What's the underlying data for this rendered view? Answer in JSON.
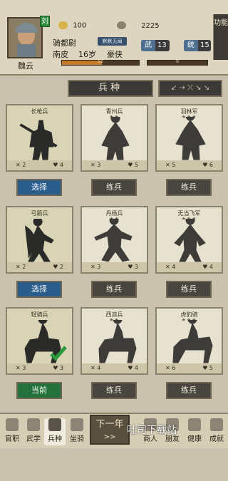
{
  "player": {
    "faction": "刘",
    "name": "魏云",
    "title_badge": "默默无闻",
    "gold": "100",
    "copper": "2225",
    "rank": "骑都尉",
    "place": "南皮",
    "age": "16岁",
    "trait": "豪侠"
  },
  "stats": {
    "wu_label": "武",
    "wu": "13",
    "tong_label": "统",
    "tong": "15"
  },
  "progress": {
    "left_value": 52,
    "left_max": 100,
    "right_value": 0,
    "right_max": 100
  },
  "func_label": "功能",
  "section_title": "兵种",
  "weapon_bar": "↙ ⇢ ⤫ ↘ ↘",
  "units": [
    {
      "name": "长枪兵",
      "stars": "",
      "atk": "2",
      "def": "4",
      "btn": "选择",
      "btn_type": "blue",
      "badge": ""
    },
    {
      "name": "青州兵",
      "stars": "★★",
      "atk": "3",
      "def": "5",
      "btn": "练兵",
      "btn_type": "gray",
      "badge": ""
    },
    {
      "name": "羽林军",
      "stars": "★★★",
      "atk": "5",
      "def": "6",
      "btn": "练兵",
      "btn_type": "gray",
      "badge": ""
    },
    {
      "name": "弓箭兵",
      "stars": "",
      "atk": "2",
      "def": "2",
      "btn": "选择",
      "btn_type": "blue",
      "badge": ""
    },
    {
      "name": "丹杨兵",
      "stars": "★★",
      "atk": "3",
      "def": "3",
      "btn": "练兵",
      "btn_type": "gray",
      "badge": ""
    },
    {
      "name": "无当飞军",
      "stars": "★★★",
      "atk": "4",
      "def": "4",
      "btn": "练兵",
      "btn_type": "gray",
      "badge": ""
    },
    {
      "name": "轻骑兵",
      "stars": "",
      "atk": "3",
      "def": "3",
      "btn": "当前",
      "btn_type": "green",
      "badge": ""
    },
    {
      "name": "西凉兵",
      "stars": "★★",
      "atk": "4",
      "def": "4",
      "btn": "练兵",
      "btn_type": "gray",
      "badge": ""
    },
    {
      "name": "虎豹骑",
      "stars": "★★★",
      "atk": "6",
      "def": "5",
      "btn": "练兵",
      "btn_type": "gray",
      "badge": ""
    }
  ],
  "nav": {
    "items": [
      "官职",
      "武学",
      "兵种",
      "坐骑",
      "商人",
      "朋友",
      "健康",
      "成就"
    ],
    "next_year": "下一年",
    "next_arrow": ">>"
  },
  "watermark": "吐司下载站"
}
